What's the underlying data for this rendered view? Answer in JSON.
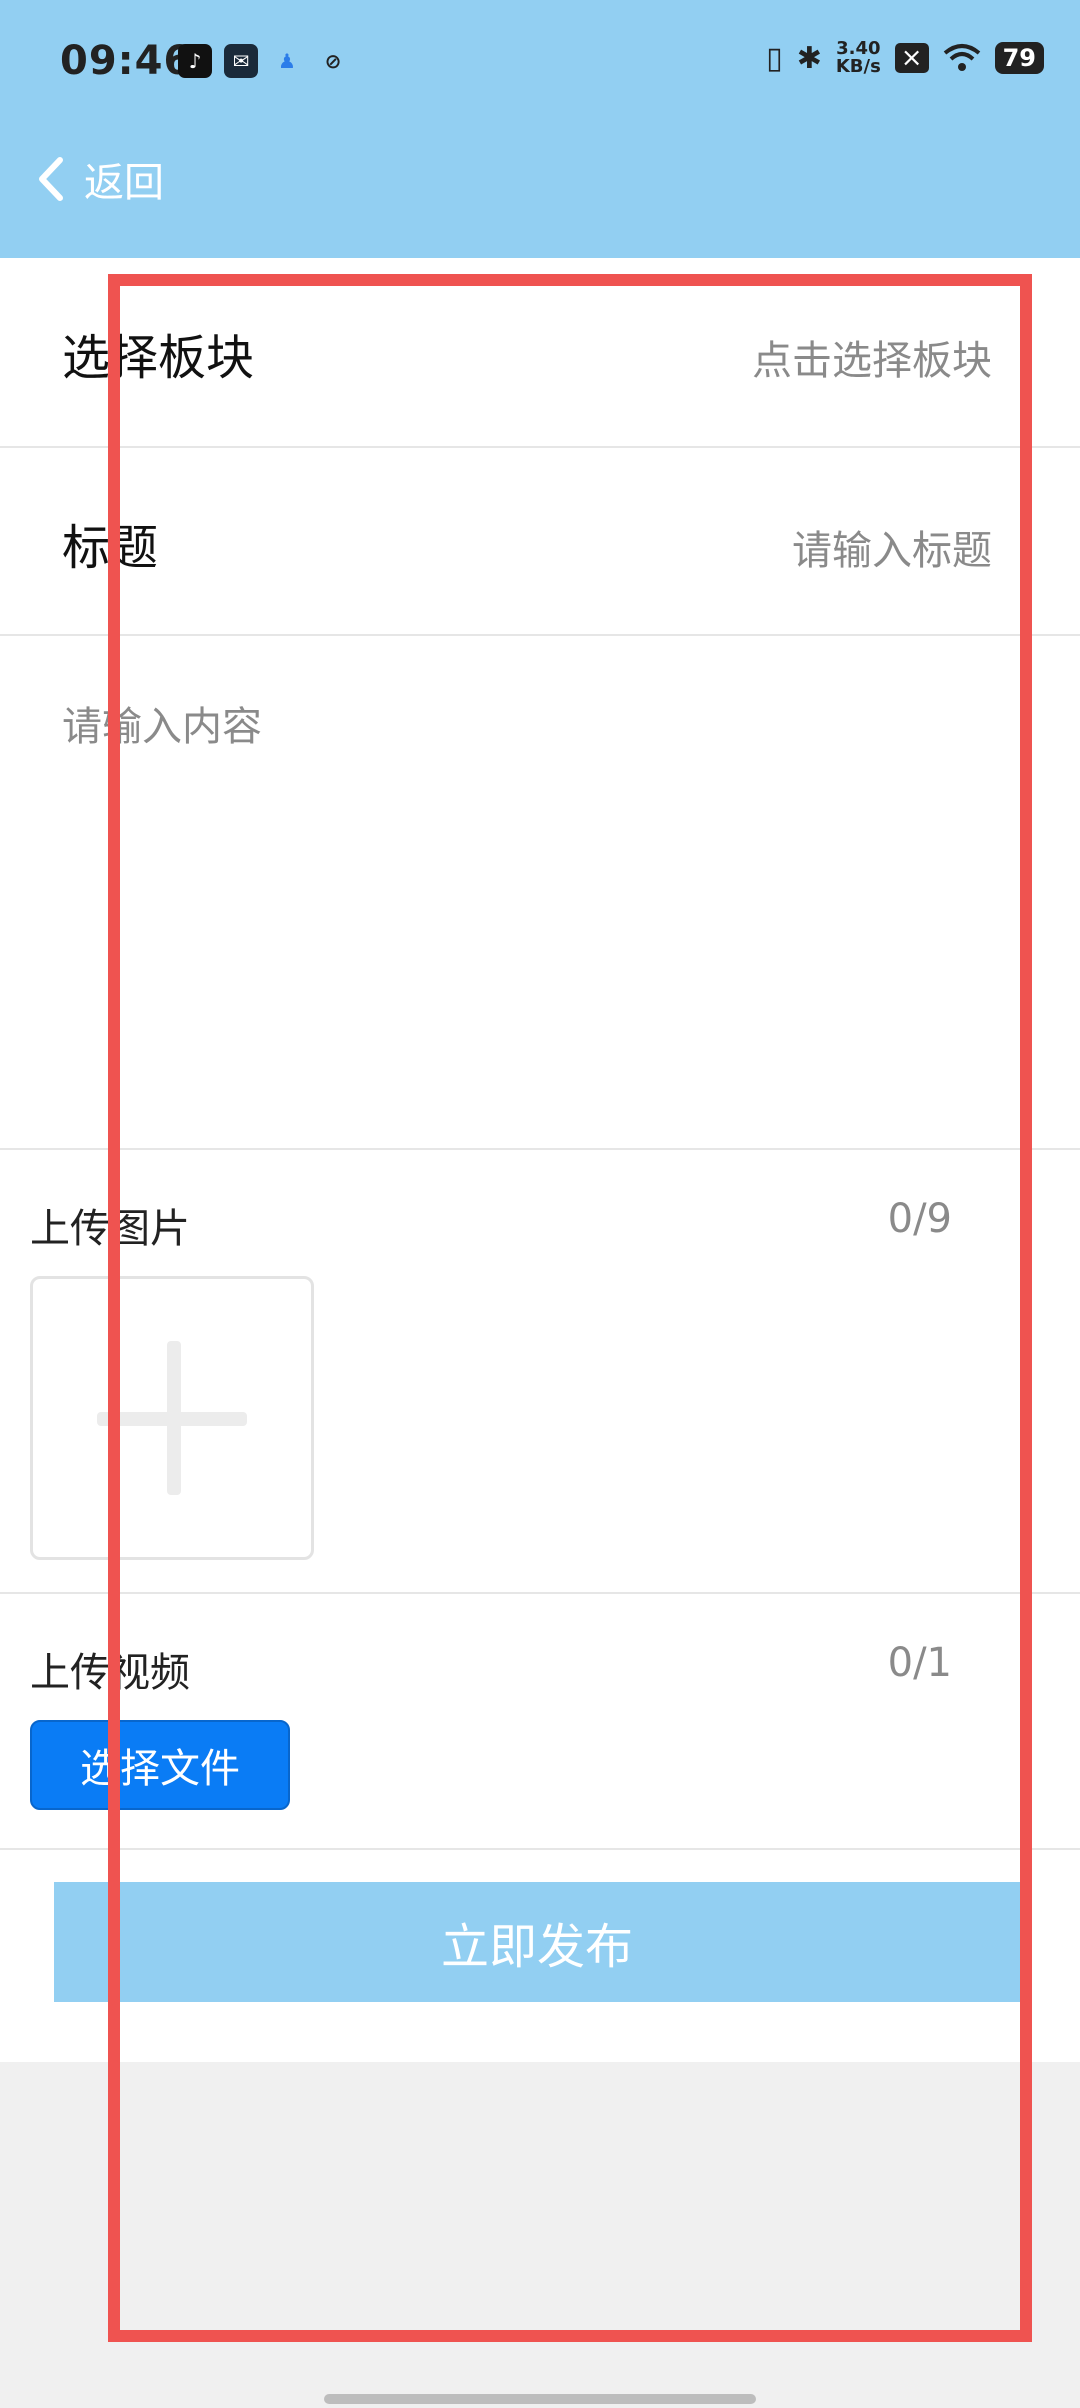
{
  "status_bar": {
    "time": "09:46",
    "net_speed_value": "3.40",
    "net_speed_unit": "KB/s",
    "battery": "79",
    "icons": [
      "tiktok-icon",
      "mail-icon",
      "qq-icon",
      "leaf-icon",
      "vibrate-icon",
      "bluetooth-icon",
      "notification-x-icon",
      "wifi-icon",
      "battery-icon"
    ]
  },
  "nav": {
    "back_label": "返回"
  },
  "form": {
    "section": {
      "label": "选择板块",
      "value": "点击选择板块"
    },
    "title": {
      "label": "标题",
      "placeholder": "请输入标题"
    },
    "content": {
      "placeholder": "请输入内容"
    },
    "images": {
      "label": "上传图片",
      "count": "0/9"
    },
    "video": {
      "label": "上传视频",
      "count": "0/1",
      "button": "选择文件"
    },
    "publish": "立即发布"
  },
  "colors": {
    "header": "#92cff2",
    "primary_button": "#0a7cf5",
    "highlight": "#ef5350"
  }
}
